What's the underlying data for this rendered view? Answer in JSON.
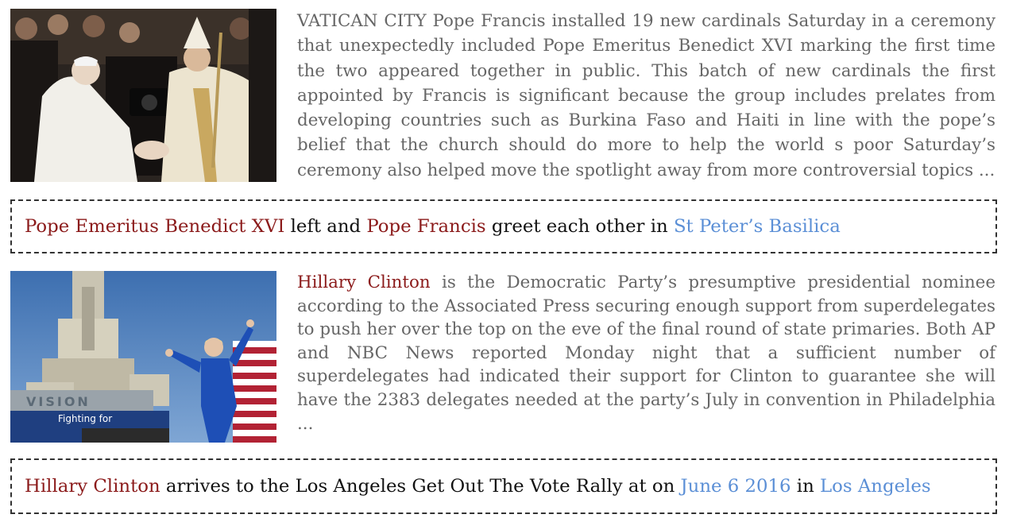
{
  "stories": [
    {
      "image": "pope-benedict-francis-greeting-photo",
      "body": "VATICAN CITY Pope Francis installed 19 new cardinals Saturday in a ceremony that unexpectedly included Pope Emeritus Benedict XVI marking the first time the two appeared together in public. This batch of new cardinals the first appointed by Francis is significant because the group includes prelates from developing countries such as Burkina Faso and Haiti in line with the pope’s belief that the church should do more to help the world s poor Saturday’s ceremony also helped move the spotlight away from more controversial topics ...",
      "caption": {
        "person1": "Pope Emeritus Benedict XVI",
        "text1": " left and ",
        "person2": "Pope Francis",
        "text2": " greet each other in ",
        "place": "St Peter’s Basilica"
      }
    },
    {
      "image": "hillary-clinton-rally-photo",
      "lead": "Hillary Clinton",
      "body": " is the Democratic Party’s presumptive presidential nominee according to the Associated Press securing enough support from superdelegates to push her over the top on the eve of the final round of state primaries. Both AP and NBC News reported Monday night that a sufficient number of superdelegates had indicated their support for Clinton to guarantee she will have the 2383 delegates needed at the party’s July in convention in Philadelphia ...",
      "photo_text": "VISION",
      "photo_banner": "Fighting for",
      "caption": {
        "person1": "Hillary Clinton",
        "text1": " arrives to the Los Angeles Get Out The Vote Rally at on ",
        "date": "June 6 2016",
        "text2": " in ",
        "place": "Los Angeles"
      }
    }
  ],
  "colors": {
    "person": "#8b1a1a",
    "place_date": "#5b8fd6",
    "body_text": "#666666",
    "caption_border": "#333333"
  }
}
